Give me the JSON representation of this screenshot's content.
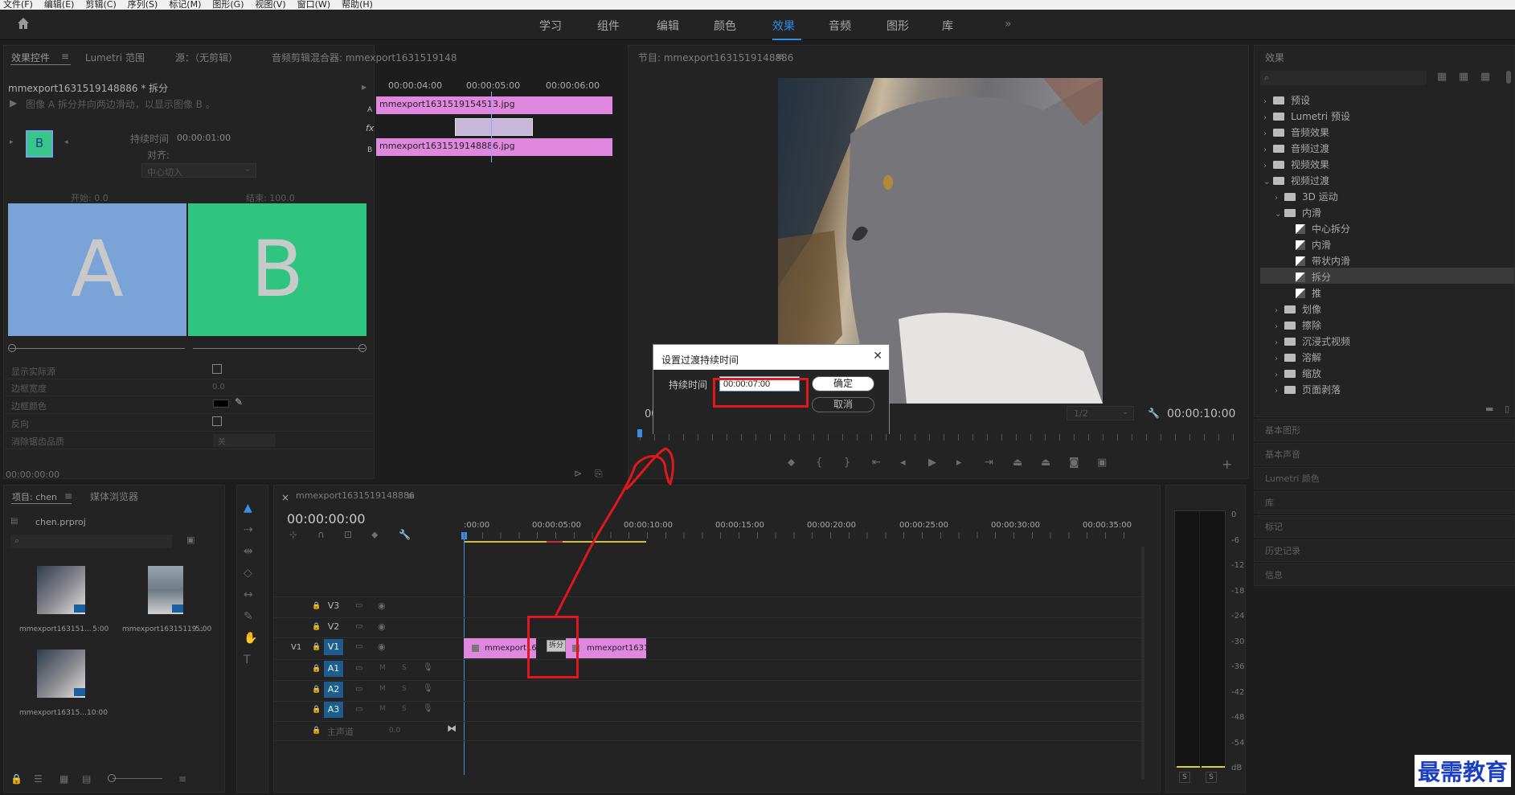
{
  "menu": [
    "文件(F)",
    "编辑(E)",
    "剪辑(C)",
    "序列(S)",
    "标记(M)",
    "图形(G)",
    "视图(V)",
    "窗口(W)",
    "帮助(H)"
  ],
  "workspaces": {
    "tabs": [
      "学习",
      "组件",
      "编辑",
      "颜色",
      "效果",
      "音频",
      "图形",
      "库"
    ],
    "active": "效果",
    "more": "»"
  },
  "source_panel": {
    "tabs": [
      "效果控件",
      "Lumetri 范围",
      "源：（无剪辑）",
      "音频剪辑混合器: mmexport1631519148886"
    ],
    "clip_title": "mmexport1631519148886 * 拆分",
    "description": "图像 A 拆分并向两边滑动，以显示图像 B 。",
    "duration_label": "持续时间",
    "duration_value": "00:00:01:00",
    "align_label": "对齐:",
    "align_value": "中心切入",
    "start_label": "开始: 0.0",
    "end_label": "结束: 100.0",
    "preview_a": "A",
    "preview_b": "B",
    "thumb_label": "B",
    "props": [
      {
        "name": "显示实际源"
      },
      {
        "name": "边框宽度",
        "value": "0.0"
      },
      {
        "name": "边框颜色"
      },
      {
        "name": "反向"
      },
      {
        "name": "消除锯齿品质",
        "value": "关"
      }
    ],
    "timecode": "00:00:00:00",
    "mini_timeline": {
      "ticks": [
        "00:00:04:00",
        "00:00:05:00",
        "00:00:06:00"
      ],
      "clip_a": "mmexport1631519154513.jpg",
      "clip_b": "mmexport1631519148886.jpg",
      "track_a": "A",
      "track_b": "B",
      "fx": "fx"
    }
  },
  "program": {
    "title": "节目: mmexport1631519148886",
    "timecode": "00:00:10:00",
    "fit": "1/2",
    "left_tc": "00"
  },
  "dialog": {
    "title": "设置过渡持续时间",
    "field_label": "持续时间",
    "field_value": "00:00:07:00",
    "ok": "确定",
    "cancel": "取消",
    "close": "✕"
  },
  "effects": {
    "title": "效果",
    "tree": [
      {
        "label": "预设",
        "level": 0,
        "kind": "folder"
      },
      {
        "label": "Lumetri 预设",
        "level": 0,
        "kind": "folder"
      },
      {
        "label": "音频效果",
        "level": 0,
        "kind": "folder"
      },
      {
        "label": "音频过渡",
        "level": 0,
        "kind": "folder"
      },
      {
        "label": "视频效果",
        "level": 0,
        "kind": "folder"
      },
      {
        "label": "视频过渡",
        "level": 0,
        "kind": "folder",
        "open": true
      },
      {
        "label": "3D 运动",
        "level": 1,
        "kind": "folder"
      },
      {
        "label": "内滑",
        "level": 1,
        "kind": "folder",
        "open": true
      },
      {
        "label": "中心拆分",
        "level": 2,
        "kind": "fx"
      },
      {
        "label": "内滑",
        "level": 2,
        "kind": "fx"
      },
      {
        "label": "带状内滑",
        "level": 2,
        "kind": "fx"
      },
      {
        "label": "拆分",
        "level": 2,
        "kind": "fx",
        "selected": true
      },
      {
        "label": "推",
        "level": 2,
        "kind": "fx"
      },
      {
        "label": "划像",
        "level": 1,
        "kind": "folder"
      },
      {
        "label": "擦除",
        "level": 1,
        "kind": "folder"
      },
      {
        "label": "沉浸式视频",
        "level": 1,
        "kind": "folder"
      },
      {
        "label": "溶解",
        "level": 1,
        "kind": "folder"
      },
      {
        "label": "缩放",
        "level": 1,
        "kind": "folder"
      },
      {
        "label": "页面剥落",
        "level": 1,
        "kind": "folder"
      }
    ],
    "collapsed": [
      "基本图形",
      "基本声音",
      "Lumetri 颜色",
      "库",
      "标记",
      "历史记录",
      "信息"
    ]
  },
  "project": {
    "tabs": [
      "项目: chen",
      "媒体浏览器"
    ],
    "file": "chen.prproj",
    "items": [
      {
        "name": "mmexport163151...",
        "dur": "5:00"
      },
      {
        "name": "mmexport16315119...",
        "dur": "5:00"
      },
      {
        "name": "mmexport16315...",
        "dur": "10:00"
      }
    ]
  },
  "timeline": {
    "title": "mmexport1631519148886",
    "timecode": "00:00:00:00",
    "ruler": [
      ":00:00",
      "00:00:05:00",
      "00:00:10:00",
      "00:00:15:00",
      "00:00:20:00",
      "00:00:25:00",
      "00:00:30:00",
      "00:00:35:00"
    ],
    "tracks": [
      "V3",
      "V2",
      "V1",
      "A1",
      "A2",
      "A3"
    ],
    "source_patch": "V1",
    "master": "主声道",
    "master_value": "0.0",
    "clip1": "mmexport163151",
    "clip2": "mmexport163151",
    "transition": "拆分",
    "mute": "M",
    "solo": "S"
  },
  "meter": {
    "ticks": [
      "0",
      "-6",
      "-12",
      "-18",
      "-24",
      "-30",
      "-36",
      "-42",
      "-48",
      "-54",
      "dB"
    ],
    "solo": [
      "S",
      "S"
    ]
  },
  "watermark": "最需教育"
}
